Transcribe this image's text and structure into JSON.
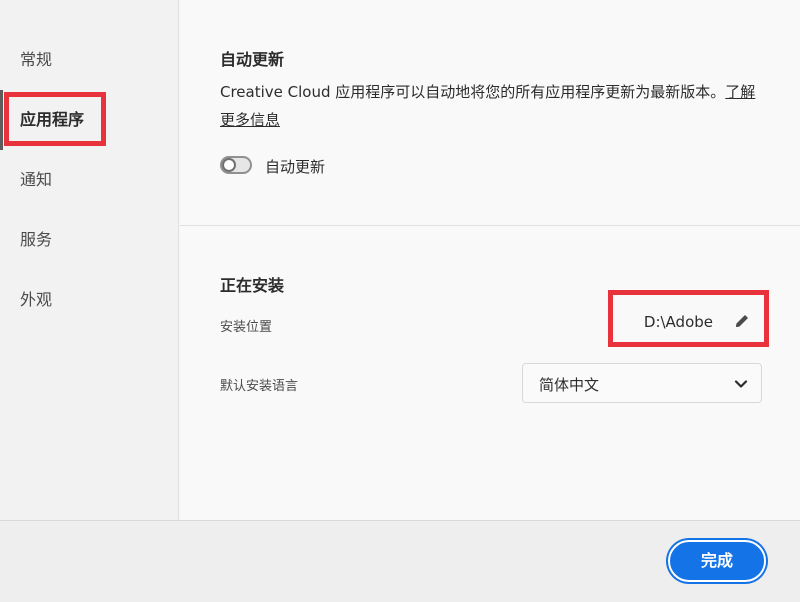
{
  "sidebar": {
    "items": [
      {
        "label": "常规"
      },
      {
        "label": "应用程序"
      },
      {
        "label": "通知"
      },
      {
        "label": "服务"
      },
      {
        "label": "外观"
      }
    ]
  },
  "auto_update": {
    "heading": "自动更新",
    "description": "Creative Cloud 应用程序可以自动地将您的所有应用程序更新为最新版本。",
    "learn_more": "了解更多信息",
    "toggle_label": "自动更新",
    "toggle_on": false
  },
  "installing": {
    "heading": "正在安装",
    "location_label": "安装位置",
    "location_value": "D:\\Adobe",
    "language_label": "默认安装语言",
    "language_value": "简体中文"
  },
  "footer": {
    "done_label": "完成"
  },
  "colors": {
    "accent": "#1473e6",
    "highlight": "#e8323c"
  },
  "icons": [
    "pencil-icon",
    "chevron-down-icon",
    "toggle-switch"
  ]
}
